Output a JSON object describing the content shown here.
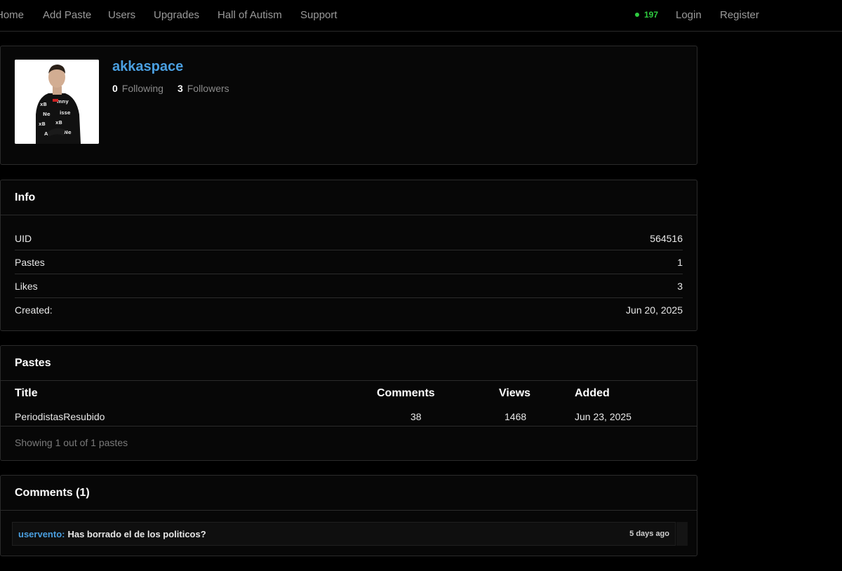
{
  "nav": {
    "links": [
      "Home",
      "Add Paste",
      "Users",
      "Upgrades",
      "Hall of Autism",
      "Support"
    ],
    "online_count": "197",
    "login": "Login",
    "register": "Register"
  },
  "profile": {
    "username": "akkaspace",
    "following_count": "0",
    "following_label": "Following",
    "followers_count": "3",
    "followers_label": "Followers"
  },
  "info": {
    "title": "Info",
    "rows": [
      {
        "label": "UID",
        "value": "564516"
      },
      {
        "label": "Pastes",
        "value": "1"
      },
      {
        "label": "Likes",
        "value": "3"
      },
      {
        "label": "Created:",
        "value": "Jun 20, 2025"
      }
    ]
  },
  "pastes": {
    "title": "Pastes",
    "columns": [
      "Title",
      "Comments",
      "Views",
      "Added"
    ],
    "rows": [
      {
        "title": "PeriodistasResubido",
        "comments": "38",
        "views": "1468",
        "added": "Jun 23, 2025"
      }
    ],
    "showing": "Showing 1 out of 1 pastes"
  },
  "comments": {
    "title": "Comments (1)",
    "items": [
      {
        "user": "uservento:",
        "text": "Has borrado el de los politicos?",
        "time": "5 days ago"
      }
    ]
  },
  "colors": {
    "accent": "#4a9fe0",
    "online": "#2ecc40",
    "background": "#000000",
    "card_border": "#2b2b2b"
  }
}
